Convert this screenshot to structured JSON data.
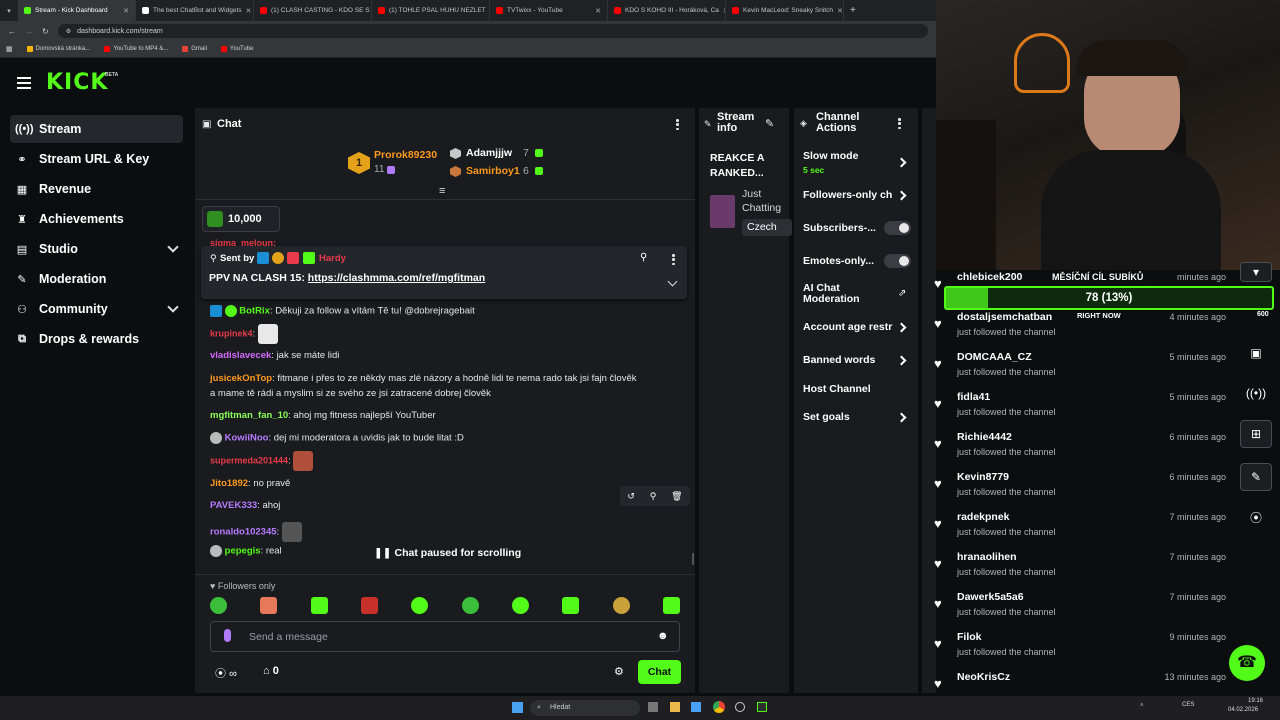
{
  "browser": {
    "tabs": [
      {
        "title": "Stream - Kick Dashboard",
        "color": "#53fc18"
      },
      {
        "title": "The best ChatBot and Widgets",
        "color": "#ffffff"
      },
      {
        "title": "(1) CLASH CASTING - KDO SE S",
        "color": "#ff0000"
      },
      {
        "title": "(1) TOHLE PSAL HUHU NEZLET",
        "color": "#ff0000"
      },
      {
        "title": "TVTwixx - YouTube",
        "color": "#ff0000"
      },
      {
        "title": "KDO S KOHO III - Horáková, Ca",
        "color": "#ff0000"
      },
      {
        "title": "Kevin MacLeod: Sneaky Snitch",
        "color": "#ff0000"
      }
    ],
    "url": "dashboard.kick.com/stream",
    "bookmarks": [
      "Domovská stránka...",
      "YouTube to MP4 &...",
      "Gmail",
      "YouTube"
    ]
  },
  "header": {
    "logo": "KICK",
    "badge": "BETA"
  },
  "sidebar": {
    "items": [
      {
        "label": "Stream",
        "icon": "(•)"
      },
      {
        "label": "Stream URL & Key",
        "icon": "∞"
      },
      {
        "label": "Revenue",
        "icon": "▦"
      },
      {
        "label": "Achievements",
        "icon": "🏆"
      },
      {
        "label": "Studio",
        "icon": "▤"
      },
      {
        "label": "Moderation",
        "icon": "🔧"
      },
      {
        "label": "Community",
        "icon": "👥"
      },
      {
        "label": "Drops & rewards",
        "icon": "⧉"
      }
    ]
  },
  "chat": {
    "title": "Chat",
    "leaderboard": {
      "first": {
        "name": "Prorok89230",
        "count": "11"
      },
      "second": {
        "name": "Adamjjjw",
        "count": "7"
      },
      "third": {
        "name": "Samirboy1",
        "count": "6"
      }
    },
    "points": "10,000",
    "partial_top": "sigma_meloun:",
    "pinned": {
      "sent_by": "Sent by",
      "user": "Hardy",
      "text": "PPV NA CLASH 15: ",
      "link": "https://clashmma.com/ref/mgfitman"
    },
    "messages": [
      {
        "user": "BotRix",
        "text": "Děkuji za follow a vítám Tě tu! @dobrejragebait",
        "color": "#53fc18"
      },
      {
        "user": "krupinek4",
        "text": "",
        "color": "#e83a4a"
      },
      {
        "user": "vladislavecek",
        "text": "jak se máte lidi",
        "color": "#d46bff"
      },
      {
        "user": "jusicekOnTop",
        "text": "fitmane i přes to ze někdy mas zlé názory a hodně lidi te nema rado tak jsi fajn člověk",
        "text2": "a mame tě rádi a myslim si ze svého ze jsi zatracené dobrej člověk",
        "color": "#ff9a1f"
      },
      {
        "user": "mgfitman_fan_10",
        "text": "ahoj mg fitness najlepší YouTuber",
        "color": "#8cff5a"
      },
      {
        "user": "KowiiNoo",
        "text": "dej mi moderatora a uvidis jak to bude litat :D",
        "color": "#b77bff"
      },
      {
        "user": "supermeda201444",
        "text": "",
        "color": "#e83a4a"
      },
      {
        "user": "Jito1892",
        "text": "no pravě",
        "color": "#ff9a1f"
      },
      {
        "user": "PAVEK333",
        "text": "ahoj",
        "color": "#b77bff"
      },
      {
        "user": "ronaldo102345",
        "text": "",
        "color": "#b77bff"
      },
      {
        "user": "pepegis",
        "text": "real",
        "color": "#53fc18"
      }
    ],
    "paused": "Chat paused for scrolling",
    "followers_only": "Followers only",
    "placeholder": "Send a message",
    "count_a": "∞",
    "count_b": "0",
    "send_label": "Chat"
  },
  "stream_info": {
    "title": "Stream info",
    "stream_title": "REAKCE A RANKED...",
    "category": "Just Chatting",
    "tag": "Czech"
  },
  "channel_actions": {
    "title": "Channel Actions",
    "slow_mode": "Slow mode",
    "slow_mode_value": "5 sec",
    "followers_only": "Followers-only ch",
    "subscribers": "Subscribers-...",
    "emotes": "Emotes-only...",
    "ai_moderation": "AI Chat Moderation",
    "account_age": "Account age restr",
    "banned_words": "Banned words",
    "host_channel": "Host Channel",
    "set_goals": "Set goals"
  },
  "activity": {
    "goal_title": "MĚSÍČNÍ CÍL SUBÍKŮ",
    "goal_value": "78 (13%)",
    "goal_percent": 13,
    "right_now": "RIGHT NOW",
    "followers": [
      {
        "name": "chlebicek200",
        "sub": "",
        "time": "minutes ago"
      },
      {
        "name": "dostaljsemchatban",
        "sub": "just followed the channel",
        "time": "4 minutes ago"
      },
      {
        "name": "DOMCAAA_CZ",
        "sub": "just followed the channel",
        "time": "5 minutes ago"
      },
      {
        "name": "fidla41",
        "sub": "just followed the channel",
        "time": "5 minutes ago"
      },
      {
        "name": "Richie4442",
        "sub": "just followed the channel",
        "time": "6 minutes ago"
      },
      {
        "name": "Kevin8779",
        "sub": "just followed the channel",
        "time": "6 minutes ago"
      },
      {
        "name": "radekpnek",
        "sub": "just followed the channel",
        "time": "7 minutes ago"
      },
      {
        "name": "hranaolihen",
        "sub": "just followed the channel",
        "time": "7 minutes ago"
      },
      {
        "name": "Dawerk5a5a6",
        "sub": "just followed the channel",
        "time": "7 minutes ago"
      },
      {
        "name": "Filok",
        "sub": "just followed the channel",
        "time": "9 minutes ago"
      },
      {
        "name": "NeoKrisCz",
        "sub": "",
        "time": "13 minutes ago"
      }
    ],
    "rail_badge": "600"
  },
  "taskbar": {
    "search": "Hledat",
    "lang": "CES",
    "time": "19:16",
    "date": "04.02.2026"
  }
}
